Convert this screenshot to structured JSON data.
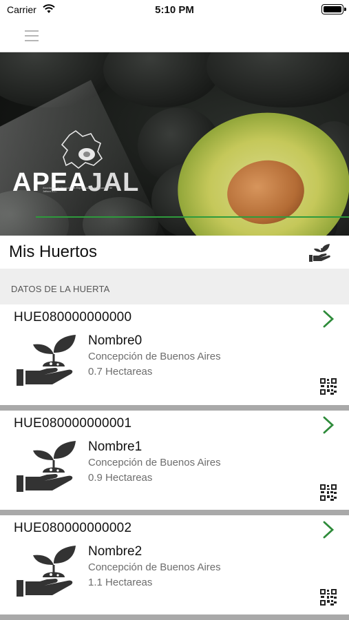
{
  "status_bar": {
    "carrier": "Carrier",
    "time": "5:10 PM"
  },
  "banner": {
    "logo_main": "APEA",
    "logo_accent": "JAL",
    "logo_subtitle": "Asociación de Productores Exportadores de Aguacate de Jalisco A.C."
  },
  "header": {
    "title": "Mis Huertos",
    "action_icon": "plant-in-hand-icon"
  },
  "section": {
    "label": "DATOS DE LA HUERTA"
  },
  "huertas": [
    {
      "id": "HUE080000000000",
      "name": "Nombre0",
      "location": "Concepción de Buenos Aires",
      "area": "0.7 Hectareas"
    },
    {
      "id": "HUE080000000001",
      "name": "Nombre1",
      "location": "Concepción de Buenos Aires",
      "area": "0.9 Hectareas"
    },
    {
      "id": "HUE080000000002",
      "name": "Nombre2",
      "location": "Concepción de Buenos Aires",
      "area": "1.1 Hectareas"
    }
  ],
  "colors": {
    "accent_green": "#2e8b3a",
    "separator_gray": "#a9a9a9",
    "section_bg": "#eeeeee"
  }
}
